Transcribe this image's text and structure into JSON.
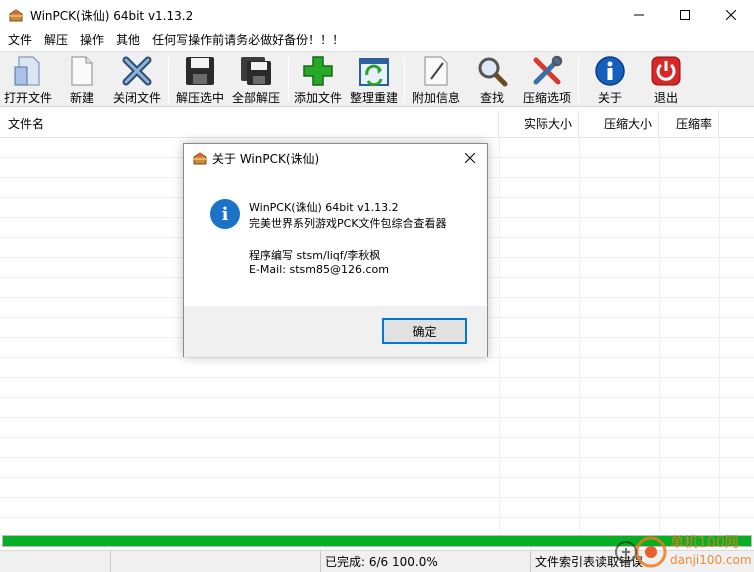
{
  "window": {
    "title": "WinPCK(诛仙) 64bit v1.13.2",
    "minimize": "minimize",
    "maximize": "maximize",
    "close": "close"
  },
  "menu": [
    {
      "label": "文件"
    },
    {
      "label": "解压"
    },
    {
      "label": "操作"
    },
    {
      "label": "其他"
    },
    {
      "label": "任何写操作前请务必做好备份！！！"
    }
  ],
  "toolbar": [
    {
      "label": "打开文件",
      "icon": "open-file-icon"
    },
    {
      "label": "新建",
      "icon": "new-file-icon"
    },
    {
      "label": "关闭文件",
      "icon": "close-file-icon"
    },
    {
      "label": "解压选中",
      "icon": "extract-selected-icon"
    },
    {
      "label": "全部解压",
      "icon": "extract-all-icon"
    },
    {
      "label": "添加文件",
      "icon": "add-file-icon"
    },
    {
      "label": "整理重建",
      "icon": "rebuild-icon"
    },
    {
      "label": "附加信息",
      "icon": "comment-icon"
    },
    {
      "label": "查找",
      "icon": "search-icon"
    },
    {
      "label": "压缩选项",
      "icon": "tools-icon"
    },
    {
      "label": "关于",
      "icon": "info-icon"
    },
    {
      "label": "退出",
      "icon": "power-icon"
    }
  ],
  "list": {
    "columns": [
      "文件名",
      "实际大小",
      "压缩大小",
      "压缩率"
    ]
  },
  "progress": {
    "value": 1.0,
    "color": "#06b025"
  },
  "status": {
    "s1": "",
    "s2": "",
    "completed": "已完成: 6/6 100.0%",
    "message": "文件索引表读取错误"
  },
  "dialog": {
    "title": "关于 WinPCK(诛仙)",
    "line1": "WinPCK(诛仙) 64bit v1.13.2",
    "line2": "完美世界系列游戏PCK文件包综合查看器",
    "line3": "程序编写 stsm/liqf/李秋枫",
    "line4": "E-Mail: stsm85@126.com",
    "ok": "确定"
  },
  "watermark": {
    "text": "单机100网",
    "url": "danji100.com"
  }
}
